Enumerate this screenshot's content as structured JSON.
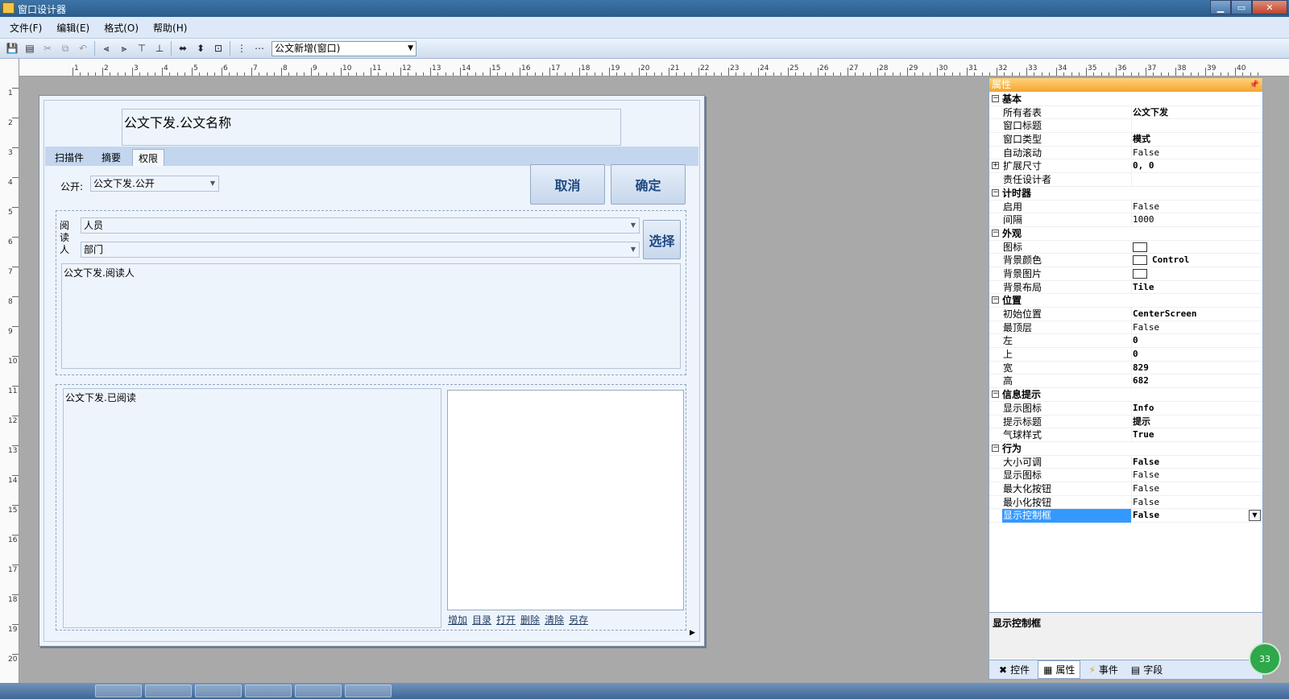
{
  "window": {
    "title": "窗口设计器"
  },
  "menu": [
    "文件(F)",
    "编辑(E)",
    "格式(O)",
    "帮助(H)"
  ],
  "toolbar": {
    "form_select": "公文新增(窗口)"
  },
  "ruler": {
    "h_labels": [
      "1",
      "2",
      "3",
      "4",
      "5",
      "6",
      "7",
      "8",
      "9",
      "10",
      "11",
      "12",
      "13",
      "14",
      "15",
      "16",
      "17",
      "18",
      "19",
      "20",
      "21",
      "22",
      "23",
      "24",
      "25",
      "26",
      "27",
      "28",
      "29",
      "30",
      "31",
      "32",
      "33",
      "34",
      "35",
      "36",
      "37",
      "38",
      "39",
      "40"
    ],
    "v_labels": [
      "1",
      "2",
      "3",
      "4",
      "5",
      "6",
      "7",
      "8",
      "9",
      "10",
      "11",
      "12",
      "13",
      "14",
      "15",
      "16",
      "17",
      "18",
      "19",
      "20"
    ]
  },
  "form": {
    "title_field": "公文下发.公文名称",
    "tabs": [
      "扫描件",
      "摘要",
      "权限"
    ],
    "active_tab": "权限",
    "public_label": "公开:",
    "public_value": "公文下发.公开",
    "cancel_label": "取消",
    "ok_label": "确定",
    "readers_label": "阅读人",
    "person_combo": "人员",
    "dept_combo": "部门",
    "select_label": "选择",
    "readers_field": "公文下发.阅读人",
    "read_field": "公文下发.已阅读",
    "attachment_links": [
      "增加",
      "目录",
      "打开",
      "删除",
      "清除",
      "另存"
    ]
  },
  "properties": {
    "header": "属性",
    "rows": [
      {
        "type": "cat",
        "name": "基本"
      },
      {
        "type": "prop",
        "name": "所有者表",
        "value": "公文下发",
        "bold": true
      },
      {
        "type": "prop",
        "name": "窗口标题",
        "value": ""
      },
      {
        "type": "prop",
        "name": "窗口类型",
        "value": "模式",
        "bold": true
      },
      {
        "type": "prop",
        "name": "自动滚动",
        "value": "False"
      },
      {
        "type": "prop",
        "name": "扩展尺寸",
        "value": "0, 0",
        "bold": true,
        "expand": true
      },
      {
        "type": "prop",
        "name": "责任设计者",
        "value": ""
      },
      {
        "type": "cat",
        "name": "计时器"
      },
      {
        "type": "prop",
        "name": "启用",
        "value": "False"
      },
      {
        "type": "prop",
        "name": "间隔",
        "value": "1000"
      },
      {
        "type": "cat",
        "name": "外观"
      },
      {
        "type": "prop",
        "name": "图标",
        "value": "",
        "swatch": true
      },
      {
        "type": "prop",
        "name": "背景颜色",
        "value": "Control",
        "swatch": true,
        "bold": true
      },
      {
        "type": "prop",
        "name": "背景图片",
        "value": "",
        "swatch": true
      },
      {
        "type": "prop",
        "name": "背景布局",
        "value": "Tile",
        "bold": true
      },
      {
        "type": "cat",
        "name": "位置"
      },
      {
        "type": "prop",
        "name": "初始位置",
        "value": "CenterScreen",
        "bold": true
      },
      {
        "type": "prop",
        "name": "最顶层",
        "value": "False"
      },
      {
        "type": "prop",
        "name": "左",
        "value": "0",
        "bold": true
      },
      {
        "type": "prop",
        "name": "上",
        "value": "0",
        "bold": true
      },
      {
        "type": "prop",
        "name": "宽",
        "value": "829",
        "bold": true
      },
      {
        "type": "prop",
        "name": "高",
        "value": "682",
        "bold": true
      },
      {
        "type": "cat",
        "name": "信息提示"
      },
      {
        "type": "prop",
        "name": "显示图标",
        "value": "Info",
        "bold": true
      },
      {
        "type": "prop",
        "name": "提示标题",
        "value": "提示",
        "bold": true
      },
      {
        "type": "prop",
        "name": "气球样式",
        "value": "True",
        "bold": true
      },
      {
        "type": "cat",
        "name": "行为"
      },
      {
        "type": "prop",
        "name": "大小可调",
        "value": "False",
        "bold": true
      },
      {
        "type": "prop",
        "name": "显示图标",
        "value": "False"
      },
      {
        "type": "prop",
        "name": "最大化按钮",
        "value": "False"
      },
      {
        "type": "prop",
        "name": "最小化按钮",
        "value": "False"
      },
      {
        "type": "prop",
        "name": "显示控制框",
        "value": "False",
        "bold": true,
        "selected": true
      }
    ],
    "description": "显示控制框",
    "bottom_tabs": [
      "控件",
      "属性",
      "事件",
      "字段"
    ],
    "active_bottom_tab": "属性"
  },
  "badge": "33"
}
